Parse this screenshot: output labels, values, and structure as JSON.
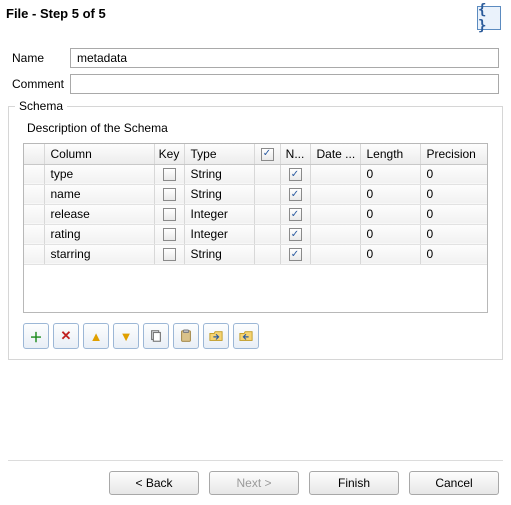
{
  "header": {
    "title": "File - Step 5 of 5"
  },
  "form": {
    "name_label": "Name",
    "name_value": "metadata",
    "comment_label": "Comment",
    "comment_value": ""
  },
  "schema": {
    "legend": "Schema",
    "description": "Description of the Schema",
    "columns": {
      "column": "Column",
      "key": "Key",
      "type": "Type",
      "n": "N...",
      "date": "Date ...",
      "length": "Length",
      "precision": "Precision"
    },
    "rows": [
      {
        "column": "type",
        "key": false,
        "type": "String",
        "n": true,
        "date": "",
        "length": "0",
        "precision": "0"
      },
      {
        "column": "name",
        "key": false,
        "type": "String",
        "n": true,
        "date": "",
        "length": "0",
        "precision": "0"
      },
      {
        "column": "release",
        "key": false,
        "type": "Integer",
        "n": true,
        "date": "",
        "length": "0",
        "precision": "0"
      },
      {
        "column": "rating",
        "key": false,
        "type": "Integer",
        "n": true,
        "date": "",
        "length": "0",
        "precision": "0"
      },
      {
        "column": "starring",
        "key": false,
        "type": "String",
        "n": true,
        "date": "",
        "length": "0",
        "precision": "0"
      }
    ]
  },
  "wizard": {
    "back": "< Back",
    "next": "Next >",
    "finish": "Finish",
    "cancel": "Cancel"
  }
}
